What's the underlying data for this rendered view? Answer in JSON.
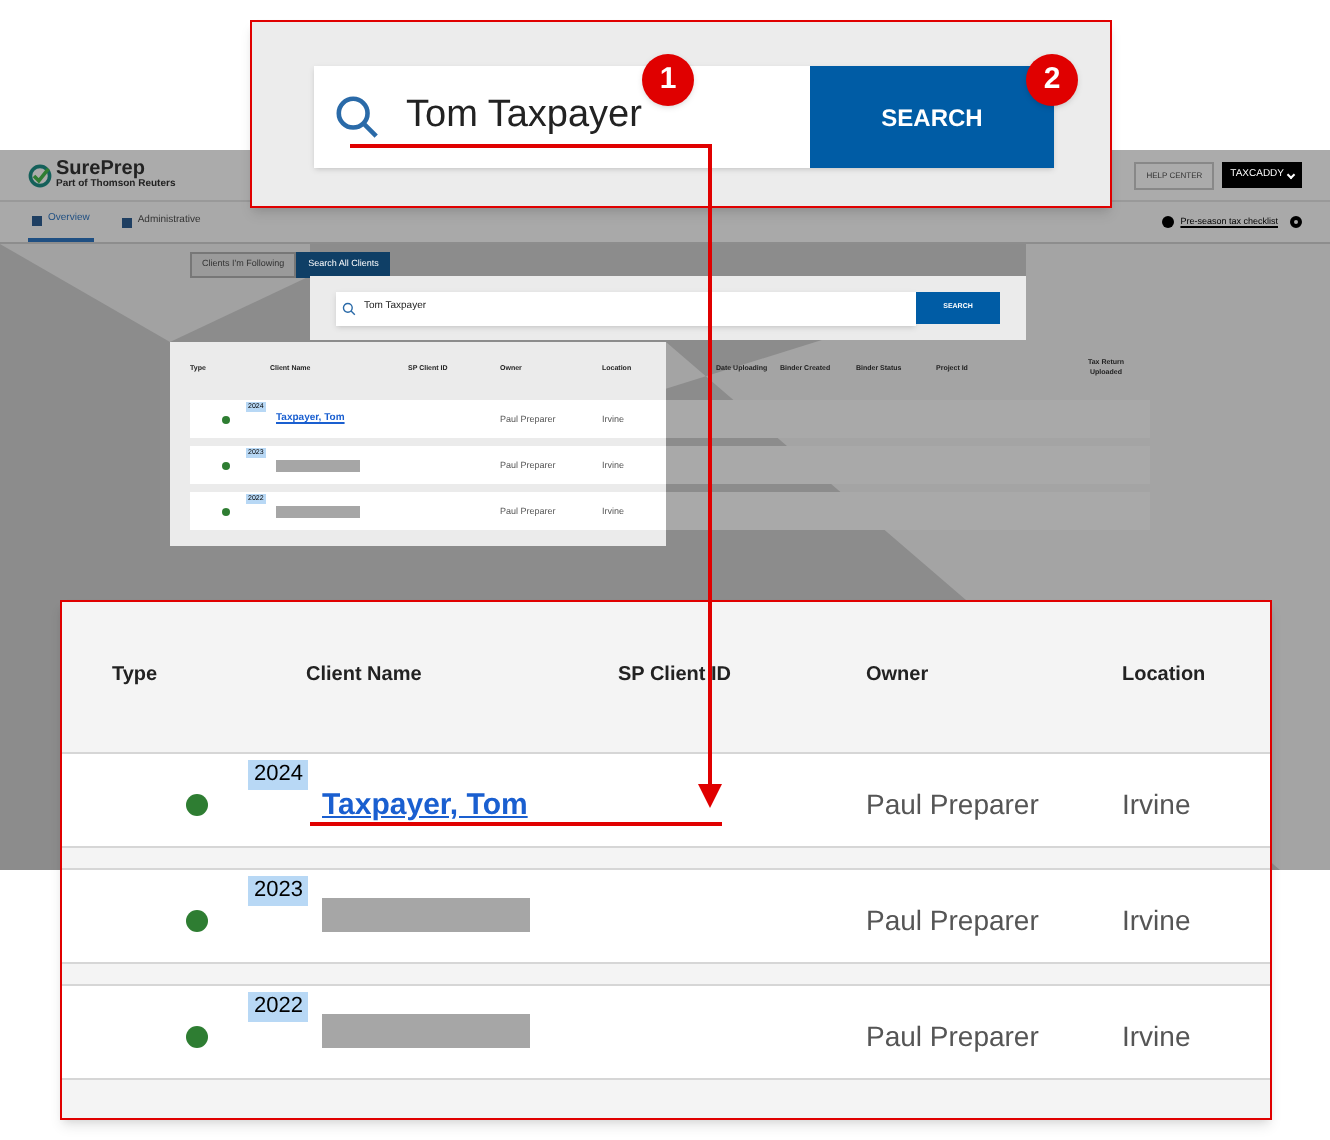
{
  "app": {
    "logo": {
      "name": "SurePrep",
      "tagline": "Part of Thomson Reuters"
    },
    "help_button": "HELP CENTER",
    "user_menu": "TAXCADDY",
    "nav_tabs": [
      {
        "label": "Overview",
        "selected": true
      },
      {
        "label": "Administrative",
        "selected": false
      }
    ],
    "checklist_link": "Pre-season tax checklist",
    "client_tabs": [
      {
        "label": "Clients I'm Following",
        "selected": false
      },
      {
        "label": "Search All Clients",
        "selected": true
      }
    ],
    "search": {
      "value": "Tom Taxpayer",
      "button": "SEARCH"
    },
    "table": {
      "columns": [
        "Type",
        "Client Name",
        "SP Client ID",
        "Owner",
        "Location",
        "Date Uploading",
        "Binder Created",
        "Binder Status",
        "Project Id",
        "Tax Return Uploaded"
      ],
      "rows": [
        {
          "color": "#2e7d32",
          "year": "2024",
          "name": {
            "kind": "link",
            "text": "Taxpayer, Tom"
          },
          "owner": "Paul Preparer",
          "location": "Irvine"
        },
        {
          "color": "#2e7d32",
          "year": "2023",
          "name": {
            "kind": "redacted"
          },
          "owner": "Paul Preparer",
          "location": "Irvine"
        },
        {
          "color": "#2e7d32",
          "year": "2022",
          "name": {
            "kind": "redacted"
          },
          "owner": "Paul Preparer",
          "location": "Irvine"
        }
      ]
    }
  },
  "search_callout": {
    "value": "Tom Taxpayer",
    "button": "SEARCH",
    "steps": [
      "1",
      "2"
    ]
  },
  "table_callout": {
    "columns": [
      "Type",
      "Client Name",
      "SP Client ID",
      "Owner",
      "Location"
    ],
    "rows": [
      {
        "color": "#2e7d32",
        "year": "2024",
        "name": {
          "kind": "link",
          "text": "Taxpayer, Tom"
        },
        "owner": "Paul Preparer",
        "location": "Irvine"
      },
      {
        "color": "#2e7d32",
        "year": "2023",
        "name": {
          "kind": "redacted"
        },
        "owner": "Paul Preparer",
        "location": "Irvine"
      },
      {
        "color": "#2e7d32",
        "year": "2022",
        "name": {
          "kind": "redacted"
        },
        "owner": "Paul Preparer",
        "location": "Irvine"
      }
    ]
  }
}
